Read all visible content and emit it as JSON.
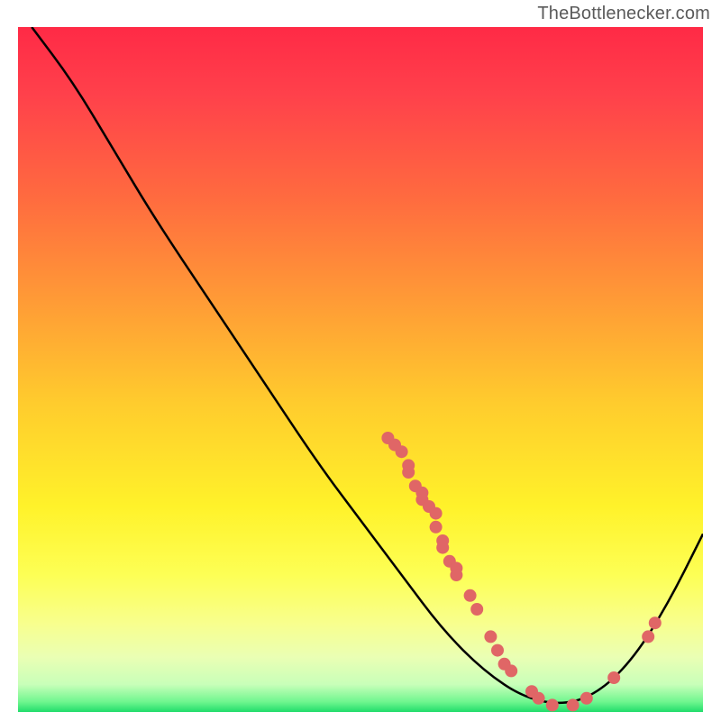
{
  "chart_data": {
    "type": "line",
    "title": "",
    "xlabel": "",
    "ylabel": "",
    "xlim": [
      0,
      100
    ],
    "ylim": [
      0,
      100
    ],
    "watermark": "TheBottlenecker.com",
    "curve_points": [
      {
        "x": 2,
        "y": 100
      },
      {
        "x": 8,
        "y": 92
      },
      {
        "x": 14,
        "y": 82
      },
      {
        "x": 20,
        "y": 72
      },
      {
        "x": 28,
        "y": 60
      },
      {
        "x": 36,
        "y": 48
      },
      {
        "x": 44,
        "y": 36
      },
      {
        "x": 50,
        "y": 28
      },
      {
        "x": 56,
        "y": 20
      },
      {
        "x": 62,
        "y": 12
      },
      {
        "x": 68,
        "y": 6
      },
      {
        "x": 74,
        "y": 2
      },
      {
        "x": 80,
        "y": 1
      },
      {
        "x": 85,
        "y": 3
      },
      {
        "x": 90,
        "y": 8
      },
      {
        "x": 95,
        "y": 16
      },
      {
        "x": 100,
        "y": 26
      }
    ],
    "dot_color": "#e06666",
    "dots": [
      {
        "x": 54,
        "y": 40
      },
      {
        "x": 55,
        "y": 39
      },
      {
        "x": 56,
        "y": 38
      },
      {
        "x": 57,
        "y": 36
      },
      {
        "x": 57,
        "y": 35
      },
      {
        "x": 58,
        "y": 33
      },
      {
        "x": 59,
        "y": 32
      },
      {
        "x": 59,
        "y": 31
      },
      {
        "x": 60,
        "y": 30
      },
      {
        "x": 61,
        "y": 29
      },
      {
        "x": 61,
        "y": 27
      },
      {
        "x": 62,
        "y": 25
      },
      {
        "x": 62,
        "y": 24
      },
      {
        "x": 63,
        "y": 22
      },
      {
        "x": 64,
        "y": 21
      },
      {
        "x": 64,
        "y": 20
      },
      {
        "x": 66,
        "y": 17
      },
      {
        "x": 67,
        "y": 15
      },
      {
        "x": 69,
        "y": 11
      },
      {
        "x": 70,
        "y": 9
      },
      {
        "x": 71,
        "y": 7
      },
      {
        "x": 72,
        "y": 6
      },
      {
        "x": 75,
        "y": 3
      },
      {
        "x": 76,
        "y": 2
      },
      {
        "x": 78,
        "y": 1
      },
      {
        "x": 81,
        "y": 1
      },
      {
        "x": 83,
        "y": 2
      },
      {
        "x": 87,
        "y": 5
      },
      {
        "x": 92,
        "y": 11
      },
      {
        "x": 93,
        "y": 13
      }
    ]
  }
}
